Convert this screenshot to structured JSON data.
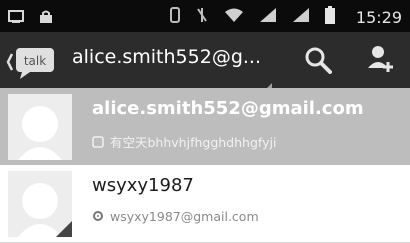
{
  "status_bar": {
    "time": "15:29",
    "icons": [
      "screen-icon",
      "lock-icon",
      "data-icon",
      "mute-icon",
      "wifi-icon",
      "signal-icon",
      "signal-icon",
      "battery-icon"
    ]
  },
  "action_bar": {
    "app_icon": "talk-icon",
    "app_icon_label": "talk",
    "title": "alice.smith552@g...",
    "actions": [
      "search-icon",
      "add-contact-icon"
    ]
  },
  "contacts": [
    {
      "name": "alice.smith552@gmail.com",
      "status": "有空天bhhvhjfhgghdhhgfyji",
      "status_icon": "available-icon",
      "selected": true
    },
    {
      "name": "wsyxy1987",
      "status": "wsyxy1987@gmail.com",
      "status_icon": "gear-icon",
      "selected": false
    }
  ],
  "colors": {
    "status_bar": "#0b0b0b",
    "action_bar": "#2c2c2c",
    "selected_row": "#bdbdbd"
  }
}
